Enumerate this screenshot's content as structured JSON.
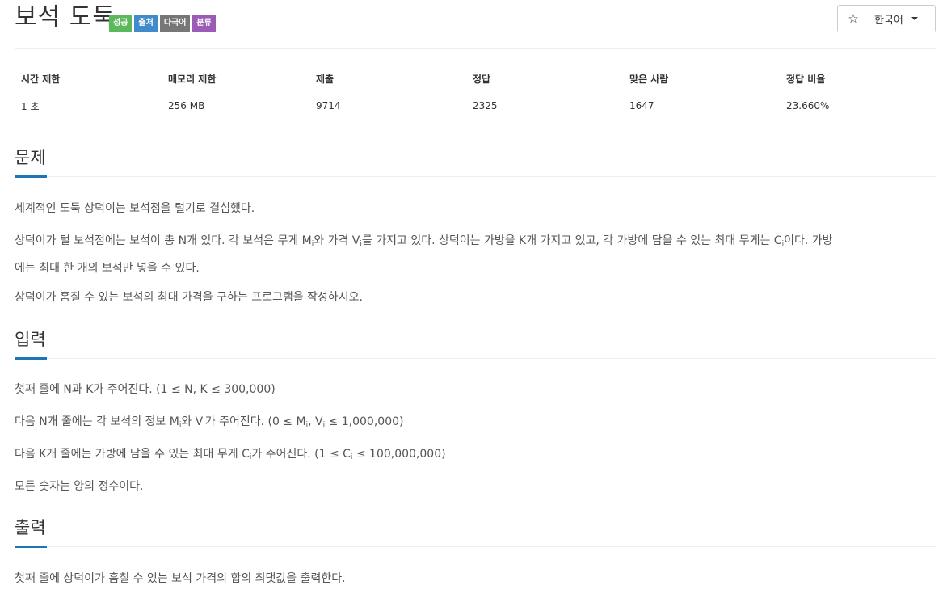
{
  "problem": {
    "title": "보석 도둑",
    "labels": [
      {
        "text": "성공",
        "color": "#5cb85c"
      },
      {
        "text": "출처",
        "color": "#428bca"
      },
      {
        "text": "다국어",
        "color": "#777777"
      },
      {
        "text": "분류",
        "color": "#9a5cb4"
      }
    ]
  },
  "toolbar": {
    "star_icon": "☆",
    "language": "한국어"
  },
  "stats": {
    "headers": [
      "시간 제한",
      "메모리 제한",
      "제출",
      "정답",
      "맞은 사람",
      "정답 비율"
    ],
    "values": [
      "1 초",
      "256 MB",
      "9714",
      "2325",
      "1647",
      "23.660%"
    ]
  },
  "sections": {
    "problem": {
      "title": "문제",
      "p1": "세계적인 도둑 상덕이는 보석점을 털기로 결심했다.",
      "p2a": "상덕이가 털 보석점에는 보석이 총 N개 있다. 각 보석은 무게 M",
      "p2b": "와 가격 V",
      "p2c": "를 가지고 있다. 상덕이는 가방을 K개 가지고 있고, 각 가방에 담을 수 있는 최대 무게는 C",
      "p2d": "이다. 가방",
      "p2e": "에는 최대 한 개의 보석만 넣을 수 있다.",
      "sub": "i",
      "p3": "상덕이가 훔칠 수 있는 보석의 최대 가격을 구하는 프로그램을 작성하시오."
    },
    "input": {
      "title": "입력",
      "l1": "첫째 줄에 N과 K가 주어진다. (1 ≤ N, K ≤ 300,000)",
      "l2a": "다음 N개 줄에는 각 보석의 정보 M",
      "l2b": "와 V",
      "l2c": "가 주어진다. (0 ≤ M",
      "l2d": ", V",
      "l2e": " ≤ 1,000,000)",
      "l3a": "다음 K개 줄에는 가방에 담을 수 있는 최대 무게 C",
      "l3b": "가 주어진다. (1 ≤ C",
      "l3c": " ≤ 100,000,000)",
      "l4": "모든 숫자는 양의 정수이다."
    },
    "output": {
      "title": "출력",
      "l1": "첫째 줄에 상덕이가 훔칠 수 있는 보석 가격의 합의 최댓값을 출력한다."
    }
  }
}
